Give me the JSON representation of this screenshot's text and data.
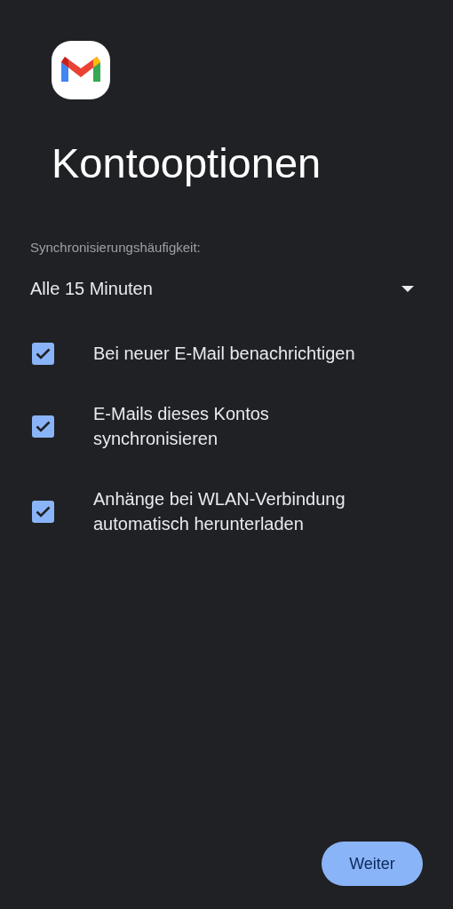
{
  "title": "Kontooptionen",
  "sync_frequency": {
    "label": "Synchronisierungshäufigkeit:",
    "value": "Alle 15 Minuten"
  },
  "options": [
    {
      "label": "Bei neuer E-Mail benachrichtigen",
      "checked": true
    },
    {
      "label": "E-Mails dieses Kontos synchronisieren",
      "checked": true
    },
    {
      "label": "Anhänge bei WLAN-Verbindung automatisch herunterladen",
      "checked": true
    }
  ],
  "next_button": "Weiter"
}
